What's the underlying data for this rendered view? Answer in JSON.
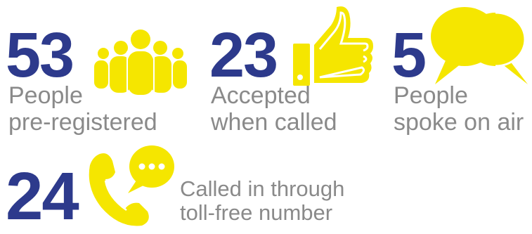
{
  "stats": [
    {
      "value": "53",
      "label_line1": "People",
      "label_line2": "pre-registered",
      "icon": "people-group-icon"
    },
    {
      "value": "23",
      "label_line1": "Accepted",
      "label_line2": "when called",
      "icon": "thumbs-up-icon"
    },
    {
      "value": "5",
      "label_line1": "People",
      "label_line2": "spoke on air",
      "icon": "speech-bubbles-icon"
    },
    {
      "value": "24",
      "label_line1": "Called in through",
      "label_line2": "toll-free number",
      "icon": "phone-chat-icon"
    }
  ],
  "colors": {
    "number": "#2d3a8c",
    "label": "#8a8a8a",
    "icon": "#f5e600"
  }
}
